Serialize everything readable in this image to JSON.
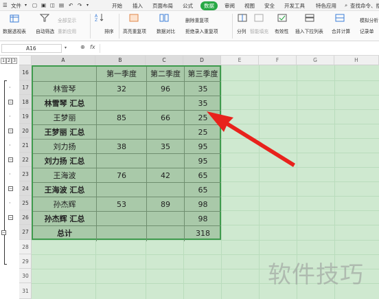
{
  "menu": {
    "file": "文件",
    "items": [
      "开始",
      "插入",
      "页面布局",
      "公式",
      "数据",
      "审阅",
      "视图",
      "安全",
      "开发工具",
      "特色应用"
    ],
    "active_index": 4,
    "search": "查找命令、搜索"
  },
  "ribbon": {
    "pivot": "数据透视表",
    "autofilter": "自动筛选",
    "show_all": "全部显示",
    "reapply": "重新应用",
    "sort": "排序",
    "highlight_dup": "高亮重复项",
    "compare": "数据对比",
    "remove_dup": "删除重复项",
    "reject_dup": "拒绝录入重复项",
    "split": "分列",
    "smart_fill": "智能填充",
    "validity": "有效性",
    "dropdown": "插入下拉列表",
    "consolidate": "合并计算",
    "simulate": "模拟分析",
    "record": "记录单"
  },
  "formula_bar": {
    "cell_ref": "A16",
    "fx": "fx",
    "zoom_icon": "zoom-icon"
  },
  "outline_levels": [
    "1",
    "2",
    "3"
  ],
  "columns": [
    "A",
    "B",
    "C",
    "D",
    "E",
    "F",
    "G",
    "H"
  ],
  "rows": [
    "16",
    "17",
    "18",
    "19",
    "20",
    "21",
    "22",
    "23",
    "24",
    "25",
    "26",
    "27",
    "28",
    "29",
    "30",
    "31"
  ],
  "table": {
    "header": [
      "",
      "第一季度",
      "第二季度",
      "第三季度"
    ],
    "rows": [
      [
        "林雪琴",
        "32",
        "96",
        "35"
      ],
      [
        "林雪琴 汇总",
        "",
        "",
        "35"
      ],
      [
        "王梦丽",
        "85",
        "66",
        "25"
      ],
      [
        "王梦丽 汇总",
        "",
        "",
        "25"
      ],
      [
        "刘力扬",
        "38",
        "35",
        "95"
      ],
      [
        "刘力扬 汇总",
        "",
        "",
        "95"
      ],
      [
        "王海波",
        "76",
        "42",
        "65"
      ],
      [
        "王海波 汇总",
        "",
        "",
        "65"
      ],
      [
        "孙杰辉",
        "53",
        "89",
        "98"
      ],
      [
        "孙杰辉 汇总",
        "",
        "",
        "98"
      ],
      [
        "总计",
        "",
        "",
        "318"
      ]
    ],
    "bold_rows": [
      1,
      3,
      5,
      7,
      9,
      10
    ]
  },
  "watermark": "软件技巧",
  "colors": {
    "accent": "#27a844",
    "arrow": "#e8221c",
    "selection": "#cfe9d0",
    "table_fill": "#a9c9a9"
  }
}
